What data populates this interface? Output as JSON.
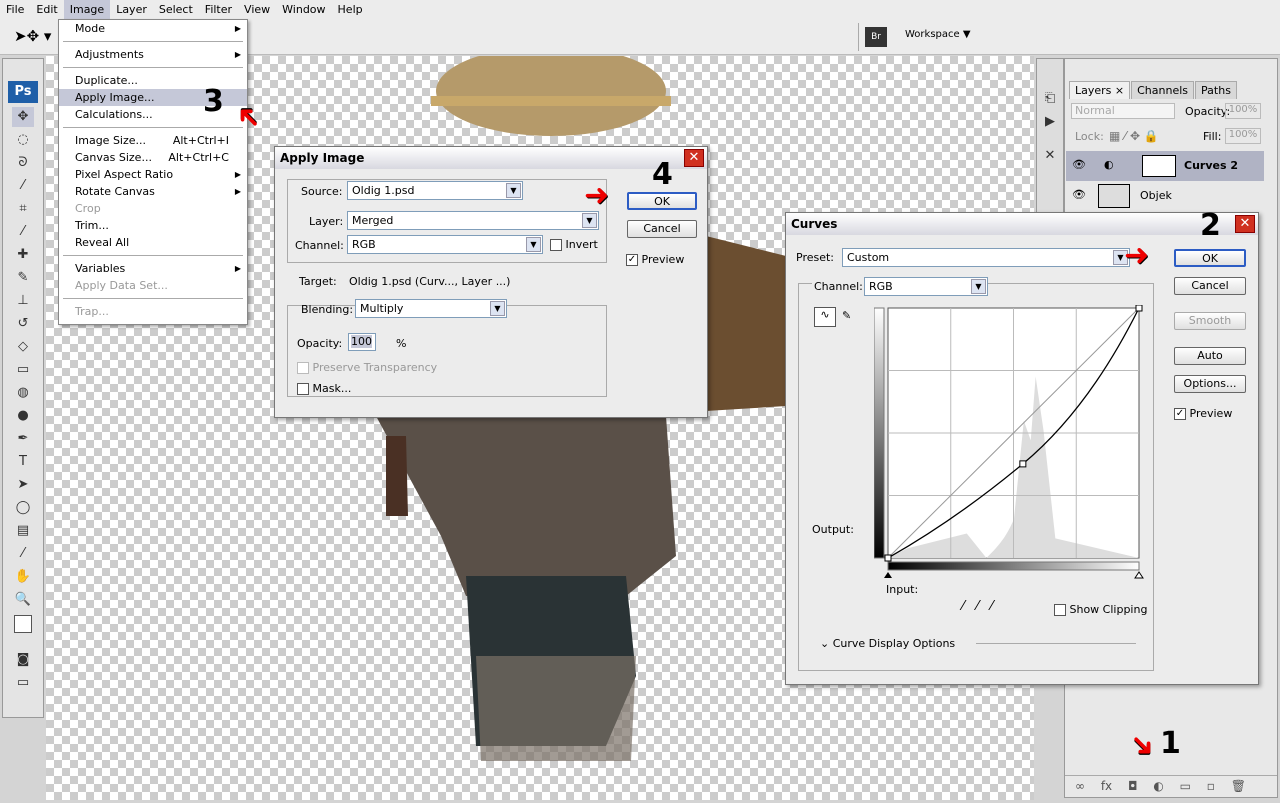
{
  "menubar": [
    "File",
    "Edit",
    "Image",
    "Layer",
    "Select",
    "Filter",
    "View",
    "Window",
    "Help"
  ],
  "optbar": {
    "workspace": "Workspace",
    "bridge": "Br"
  },
  "toolbox": {
    "logo": "Ps"
  },
  "image_menu": [
    {
      "label": "Mode",
      "arrow": true
    },
    {
      "sep": true
    },
    {
      "label": "Adjustments",
      "arrow": true
    },
    {
      "sep": true
    },
    {
      "label": "Duplicate..."
    },
    {
      "label": "Apply Image...",
      "highlight": true
    },
    {
      "label": "Calculations..."
    },
    {
      "sep": true
    },
    {
      "label": "Image Size...",
      "shortcut": "Alt+Ctrl+I"
    },
    {
      "label": "Canvas Size...",
      "shortcut": "Alt+Ctrl+C"
    },
    {
      "label": "Pixel Aspect Ratio",
      "arrow": true
    },
    {
      "label": "Rotate Canvas",
      "arrow": true
    },
    {
      "label": "Crop",
      "disabled": true
    },
    {
      "label": "Trim..."
    },
    {
      "label": "Reveal All"
    },
    {
      "sep": true
    },
    {
      "label": "Variables",
      "arrow": true
    },
    {
      "label": "Apply Data Set...",
      "disabled": true
    },
    {
      "sep": true
    },
    {
      "label": "Trap...",
      "disabled": true
    }
  ],
  "apply_image": {
    "title": "Apply Image",
    "source_label": "Source:",
    "source": "Oldig 1.psd",
    "layer_label": "Layer:",
    "layer": "Merged",
    "channel_label": "Channel:",
    "channel": "RGB",
    "invert": "Invert",
    "invert_checked": false,
    "target_label": "Target:",
    "target": "Oldig 1.psd (Curv..., Layer ...)",
    "blending_label": "Blending:",
    "blending": "Multiply",
    "opacity_label": "Opacity:",
    "opacity": "100",
    "opacity_unit": "%",
    "preserve": "Preserve Transparency",
    "mask": "Mask...",
    "ok": "OK",
    "cancel": "Cancel",
    "preview": "Preview",
    "preview_checked": true
  },
  "curves": {
    "title": "Curves",
    "preset_label": "Preset:",
    "preset": "Custom",
    "channel_label": "Channel:",
    "channel": "RGB",
    "output_label": "Output:",
    "input_label": "Input:",
    "show_clipping": "Show Clipping",
    "display_options": "Curve Display Options",
    "ok": "OK",
    "cancel": "Cancel",
    "smooth": "Smooth",
    "auto": "Auto",
    "options": "Options...",
    "preview": "Preview",
    "preview_checked": true,
    "points": [
      [
        0,
        0
      ],
      [
        137,
        96
      ],
      [
        255,
        255
      ]
    ]
  },
  "layers_panel": {
    "tabs": [
      "Layers",
      "Channels",
      "Paths"
    ],
    "blend_mode": "Normal",
    "opacity_label": "Opacity:",
    "opacity": "100%",
    "lock_label": "Lock:",
    "fill_label": "Fill:",
    "fill": "100%",
    "layers": [
      {
        "name": "Curves 2",
        "selected": true
      },
      {
        "name": "Objek",
        "selected": false
      }
    ]
  },
  "annotations": {
    "step1": "1",
    "step2": "2",
    "step3": "3",
    "step4": "4",
    "arrow_color": "#e00000"
  }
}
